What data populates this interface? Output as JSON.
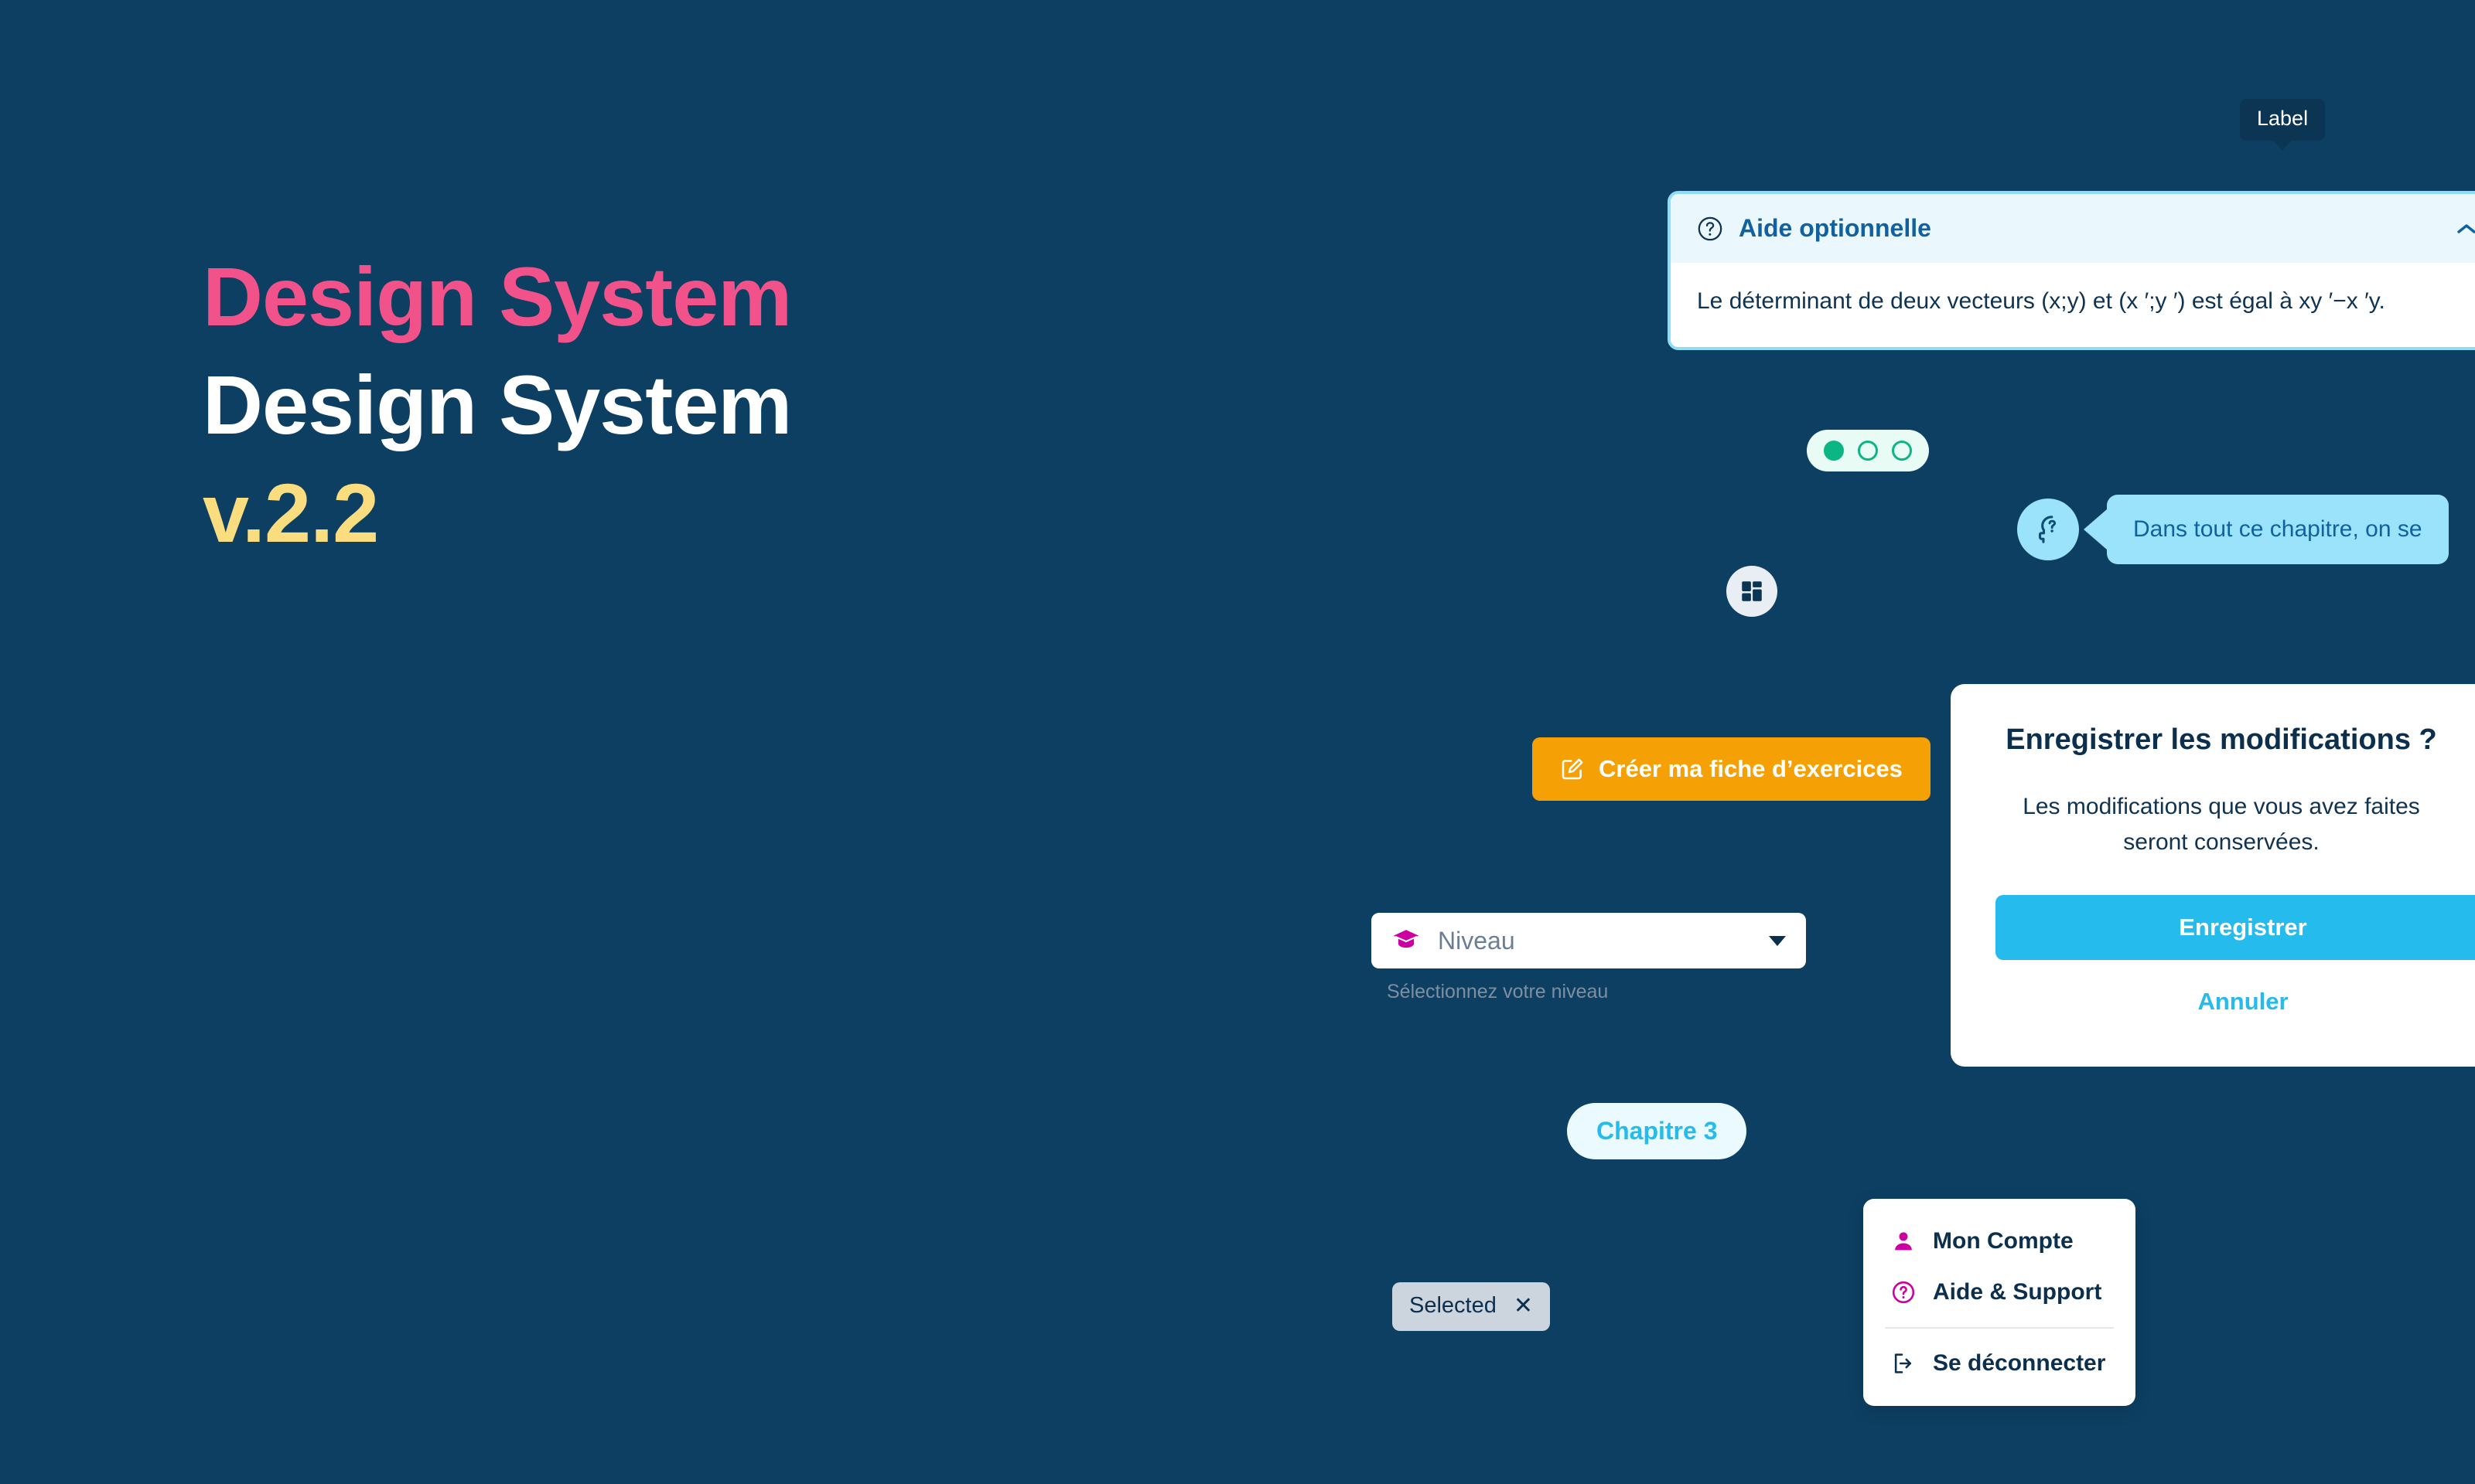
{
  "theme": {
    "background": "#0d3f62",
    "pink": "#f2528a",
    "white": "#ffffff",
    "yellow": "#fadd7f",
    "cyan": "#25bbed",
    "light_cyan": "#9ae3fb",
    "orange": "#f5a105",
    "magenta": "#cc00a0",
    "teal": "#0cb584",
    "navy": "#0b2f4d"
  },
  "hero": {
    "line1": "Design System",
    "line2": "Design System",
    "line3": "v.2.2"
  },
  "tooltip": {
    "label": "Label"
  },
  "accordion": {
    "title": "Aide optionnelle",
    "icon": "question-circle-icon",
    "chevron": "chevron-up-icon",
    "expanded": true,
    "body": "Le déterminant de deux vecteurs (x;y) et (x ′;y ′) est égal à xy ′−x ′y."
  },
  "pagination": {
    "total": 3,
    "active_index": 0
  },
  "grid_button": {
    "icon": "dashboard-grid-icon"
  },
  "speech_bubble": {
    "avatar_icon": "head-question-icon",
    "text": "Dans tout ce chapitre, on se"
  },
  "create_button": {
    "icon": "edit-square-icon",
    "label": "Créer ma fiche d’exercices"
  },
  "modal": {
    "title": "Enregistrer les modifications ?",
    "body": "Les modifications que vous avez faites seront conservées.",
    "primary_label": "Enregistrer",
    "secondary_label": "Annuler"
  },
  "select": {
    "icon": "graduation-cap-icon",
    "value": "Niveau",
    "placeholder": "Niveau",
    "caret": "chevron-down-icon",
    "hint": "Sélectionnez votre niveau",
    "options": [
      "Niveau"
    ]
  },
  "chapter_pill": {
    "label": "Chapitre 3"
  },
  "chip": {
    "label": "Selected",
    "close_icon": "close-icon",
    "close_glyph": "✕"
  },
  "menu": {
    "items": [
      {
        "label": "Mon Compte",
        "icon": "user-icon"
      },
      {
        "label": "Aide & Support",
        "icon": "question-circle-icon"
      },
      {
        "label": "Se déconnecter",
        "icon": "logout-icon"
      }
    ]
  }
}
